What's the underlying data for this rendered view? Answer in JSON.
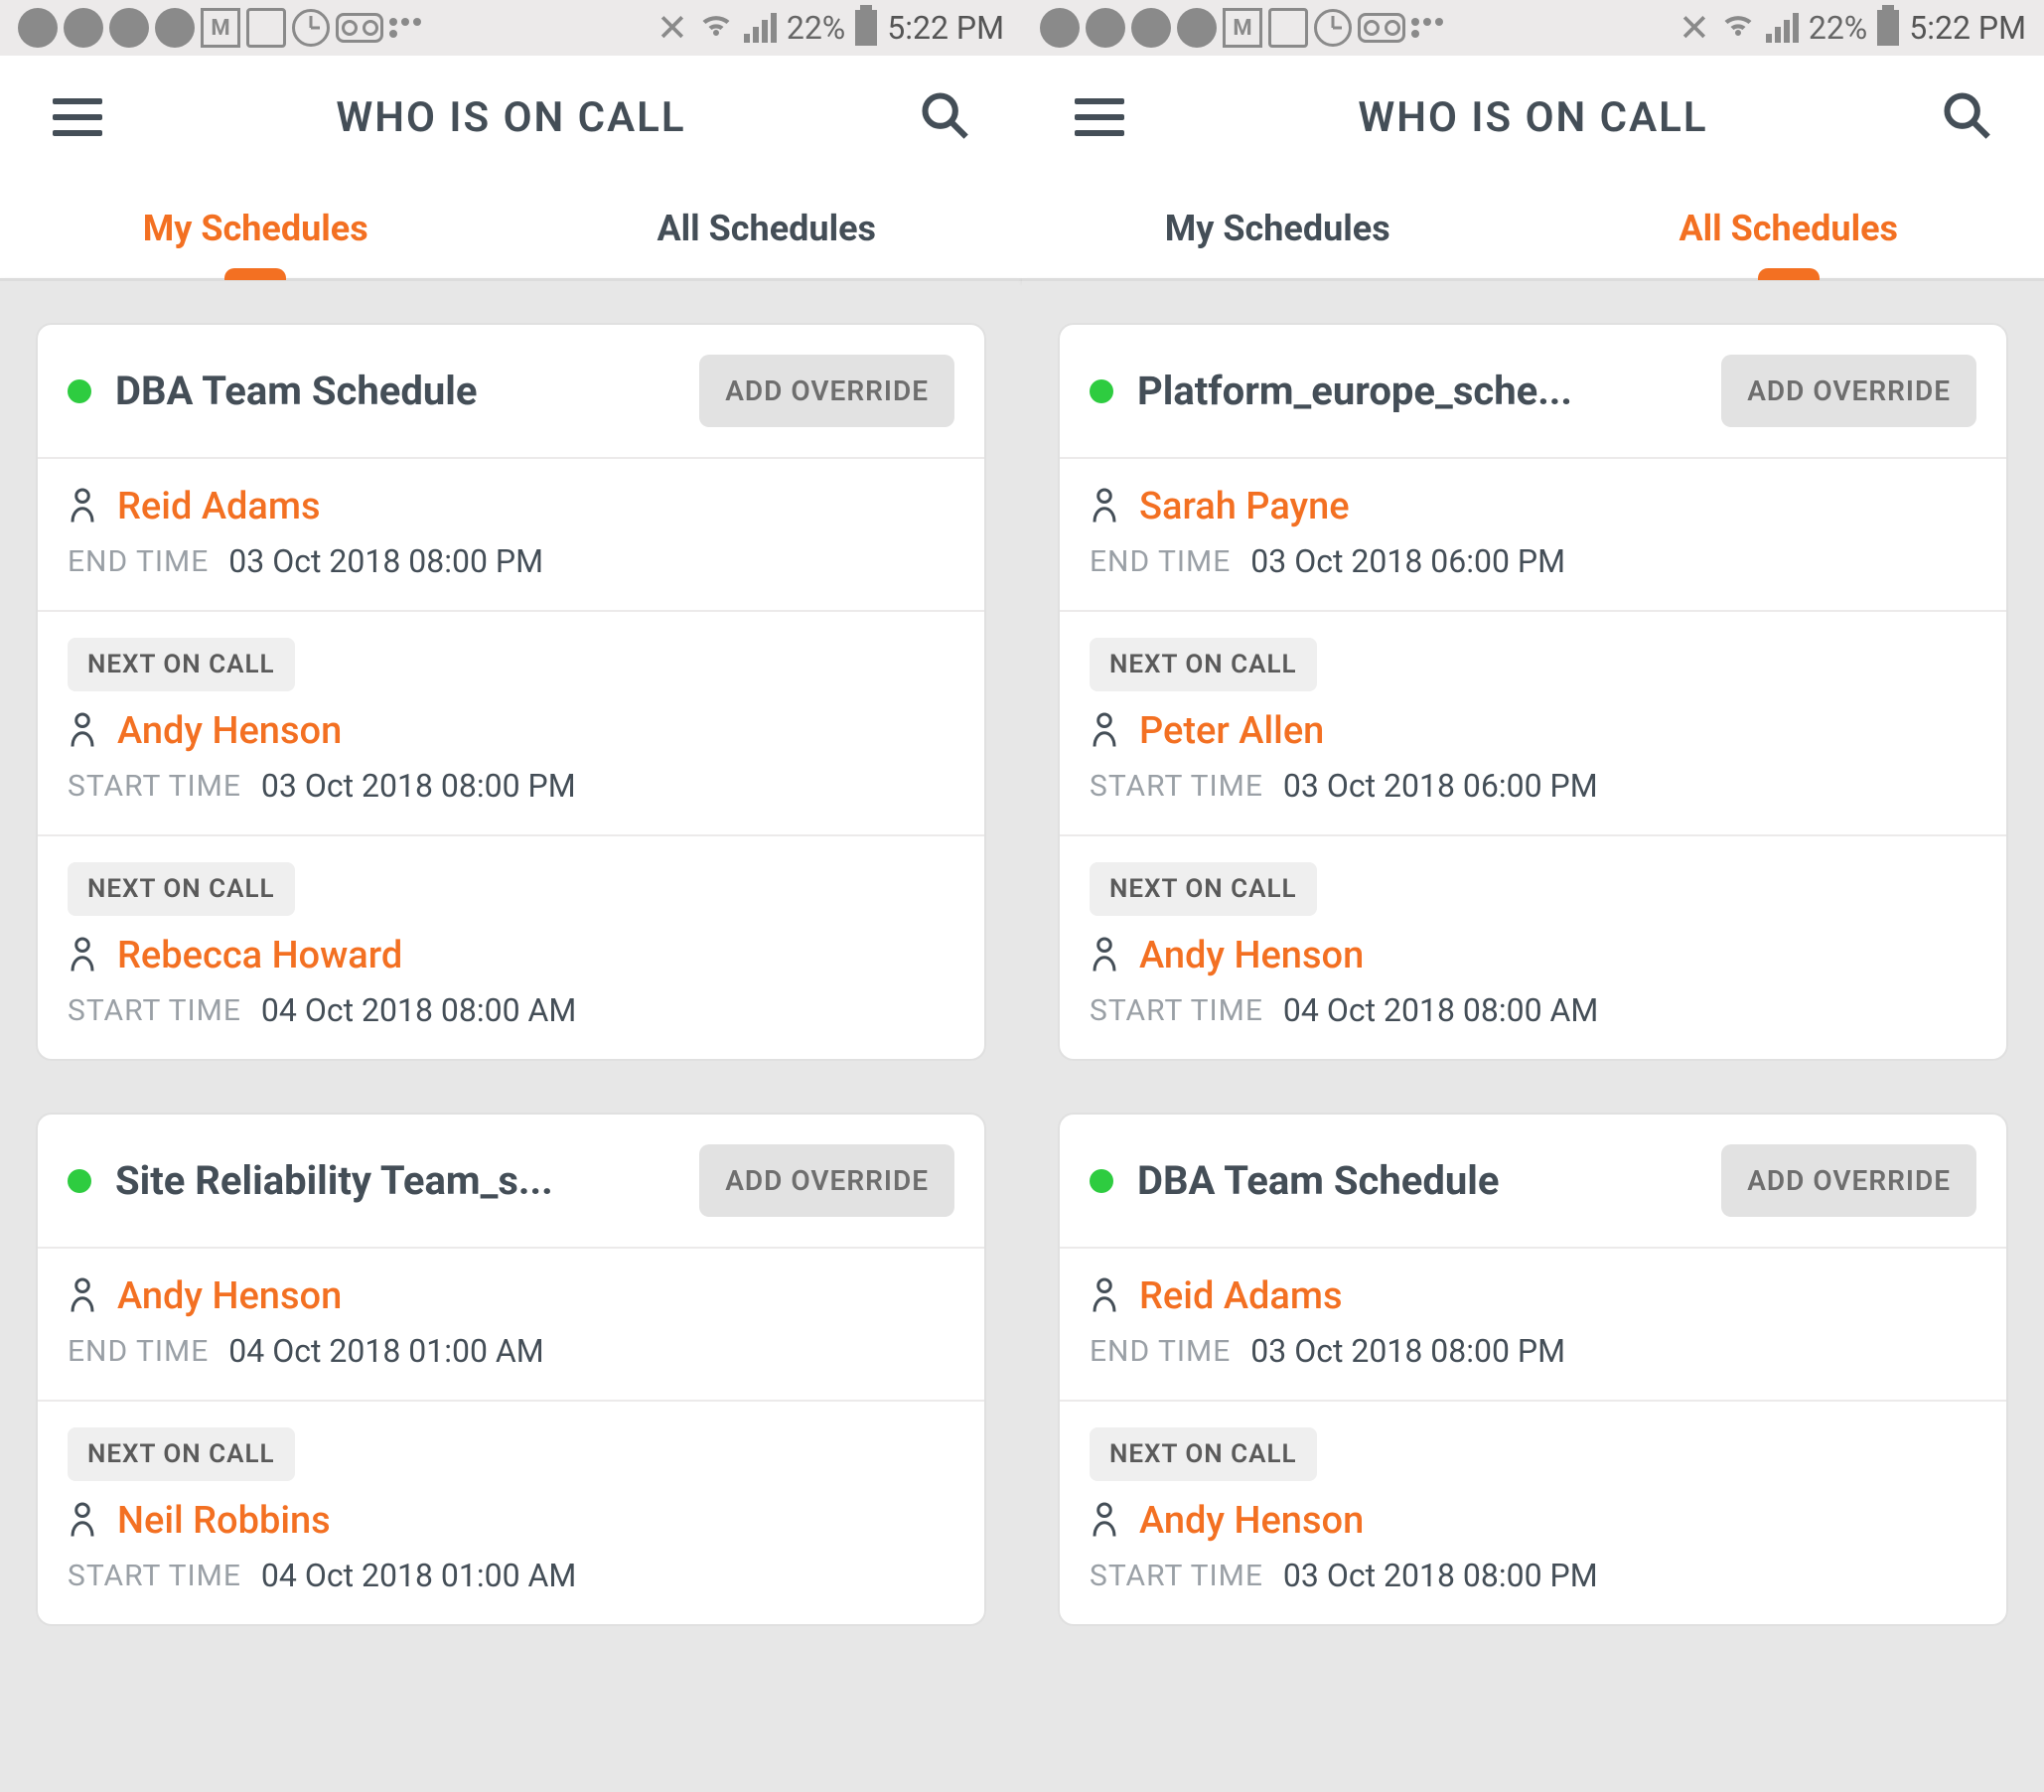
{
  "status": {
    "battery_pct": "22%",
    "time": "5:22 PM"
  },
  "app_title": "WHO IS ON CALL",
  "labels": {
    "tab_my": "My Schedules",
    "tab_all": "All Schedules",
    "add_override": "ADD OVERRIDE",
    "next_on_call": "NEXT ON CALL",
    "end_time": "END TIME",
    "start_time": "START TIME"
  },
  "panes": [
    {
      "active_tab": "my",
      "cards": [
        {
          "title": "DBA Team Schedule",
          "entries": [
            {
              "badge": null,
              "name": "Reid Adams",
              "time_kind": "end_time",
              "time": "03 Oct 2018 08:00 PM"
            },
            {
              "badge": "next_on_call",
              "name": "Andy Henson",
              "time_kind": "start_time",
              "time": "03 Oct 2018 08:00 PM"
            },
            {
              "badge": "next_on_call",
              "name": "Rebecca Howard",
              "time_kind": "start_time",
              "time": "04 Oct 2018 08:00 AM"
            }
          ]
        },
        {
          "title": "Site Reliability Team_s...",
          "entries": [
            {
              "badge": null,
              "name": "Andy Henson",
              "time_kind": "end_time",
              "time": "04 Oct 2018 01:00 AM"
            },
            {
              "badge": "next_on_call",
              "name": "Neil Robbins",
              "time_kind": "start_time",
              "time": "04 Oct 2018 01:00 AM"
            }
          ]
        }
      ]
    },
    {
      "active_tab": "all",
      "cards": [
        {
          "title": "Platform_europe_sche...",
          "entries": [
            {
              "badge": null,
              "name": "Sarah Payne",
              "time_kind": "end_time",
              "time": "03 Oct 2018 06:00 PM"
            },
            {
              "badge": "next_on_call",
              "name": "Peter Allen",
              "time_kind": "start_time",
              "time": "03 Oct 2018 06:00 PM"
            },
            {
              "badge": "next_on_call",
              "name": "Andy Henson",
              "time_kind": "start_time",
              "time": "04 Oct 2018 08:00 AM"
            }
          ]
        },
        {
          "title": "DBA Team Schedule",
          "entries": [
            {
              "badge": null,
              "name": "Reid Adams",
              "time_kind": "end_time",
              "time": "03 Oct 2018 08:00 PM"
            },
            {
              "badge": "next_on_call",
              "name": "Andy Henson",
              "time_kind": "start_time",
              "time": "03 Oct 2018 08:00 PM"
            }
          ]
        }
      ]
    }
  ]
}
